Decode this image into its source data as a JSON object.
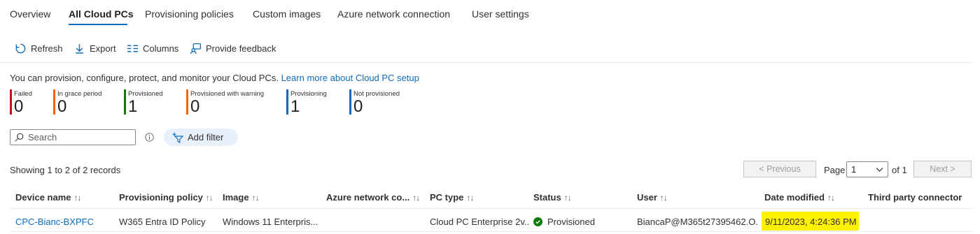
{
  "tabs": [
    {
      "label": "Overview"
    },
    {
      "label": "All Cloud PCs",
      "active": true
    },
    {
      "label": "Provisioning policies"
    },
    {
      "label": "Custom images"
    },
    {
      "label": "Azure network connection"
    },
    {
      "label": "User settings"
    }
  ],
  "toolbar": {
    "refresh_label": "Refresh",
    "export_label": "Export",
    "columns_label": "Columns",
    "feedback_label": "Provide feedback"
  },
  "info": {
    "text": "You can provision, configure, protect, and monitor your Cloud PCs.",
    "link": "Learn more about Cloud PC setup"
  },
  "tiles": [
    {
      "label": "Failed",
      "value": "0",
      "color": "#c50f1f"
    },
    {
      "label": "In grace period",
      "value": "0",
      "color": "#f7630c"
    },
    {
      "label": "Provisioned",
      "value": "1",
      "color": "#107c10"
    },
    {
      "label": "Provisioned with warning",
      "value": "0",
      "color": "#f7630c"
    },
    {
      "label": "Provisioning",
      "value": "1",
      "color": "#0f6cbd"
    },
    {
      "label": "Not provisioned",
      "value": "0",
      "color": "#0f6cbd"
    }
  ],
  "search": {
    "placeholder": "Search"
  },
  "filter": {
    "add_label": "Add filter"
  },
  "records": {
    "text": "Showing 1 to 2 of 2 records"
  },
  "pagination": {
    "previous_label": "< Previous",
    "page_label": "Page",
    "page_value": "1",
    "of_label": "of 1",
    "next_label": "Next >"
  },
  "table": {
    "columns": [
      "Device name",
      "Provisioning policy",
      "Image",
      "Azure network co...",
      "PC type",
      "Status",
      "User",
      "Date modified",
      "Third party connector"
    ],
    "sort_glyph": "↑↓",
    "rows": [
      {
        "device_name": "CPC-Bianc-BXPFC",
        "provisioning_policy": "W365 Entra ID Policy",
        "image": "Windows 11 Enterpris...",
        "azure_network": "",
        "pc_type": "Cloud PC Enterprise 2v...",
        "status": "Provisioned",
        "user": "BiancaP@M365t27395462.O...",
        "date_modified": "9/11/2023, 4:24:36 PM",
        "third_party_connector": ""
      }
    ]
  },
  "colors": {
    "accent": "#0f6cbd",
    "status_ok": "#107c10",
    "highlight": "#fff200"
  }
}
